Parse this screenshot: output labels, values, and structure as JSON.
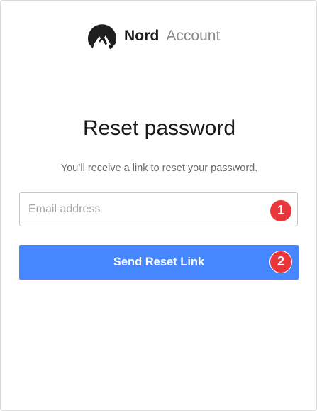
{
  "brand": {
    "name": "Nord",
    "product": "Account",
    "logo_icon": "nord-mountain-logo-icon",
    "logo_color": "#1f1f1f"
  },
  "page": {
    "title": "Reset password",
    "subtitle": "You’ll receive a link to reset your password."
  },
  "form": {
    "email_placeholder": "Email address",
    "email_value": "",
    "submit_label": "Send Reset Link",
    "submit_color": "#4687ff"
  },
  "annotations": {
    "badge_1": "1",
    "badge_2": "2",
    "badge_color": "#e8363b"
  }
}
